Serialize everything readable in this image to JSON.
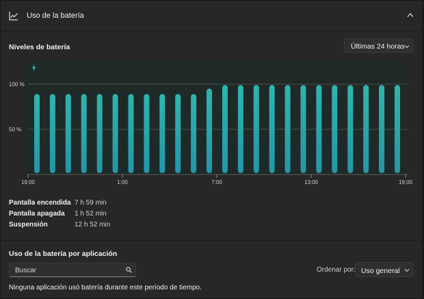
{
  "header": {
    "title": "Uso de la batería",
    "icon": "line-chart-icon",
    "collapse_icon": "chevron-up-icon"
  },
  "levels": {
    "title": "Niveles de batería",
    "range_dropdown": {
      "selected": "Últimas 24 horas"
    }
  },
  "chart_data": {
    "type": "bar",
    "y_ticks": [
      "100 %",
      "50 %"
    ],
    "x_ticks": [
      "19:00",
      "1:00",
      "7:00",
      "13:00",
      "19:00"
    ],
    "ylim": [
      0,
      100
    ],
    "values": [
      89,
      89,
      89,
      89,
      89,
      89,
      89,
      89,
      89,
      89,
      89,
      95,
      99,
      99,
      99,
      99,
      99,
      99,
      99,
      99,
      99,
      99,
      99,
      99
    ],
    "charging_icon": "lightning-icon",
    "bar_color": "#2fb5ad",
    "background_color": "#1f2a28"
  },
  "stats": [
    {
      "label": "Pantalla encendida",
      "value": "7 h 59 min"
    },
    {
      "label": "Pantalla apagada",
      "value": "1 h 52 min"
    },
    {
      "label": "Suspensión",
      "value": "12 h 52 min"
    }
  ],
  "apps": {
    "title": "Uso de la batería por aplicación",
    "search_placeholder": "Buscar",
    "sort_label": "Ordenar por:",
    "sort_dropdown": {
      "selected": "Uso general"
    },
    "empty_message": "Ninguna aplicación usó batería durante este período de tiempo."
  }
}
